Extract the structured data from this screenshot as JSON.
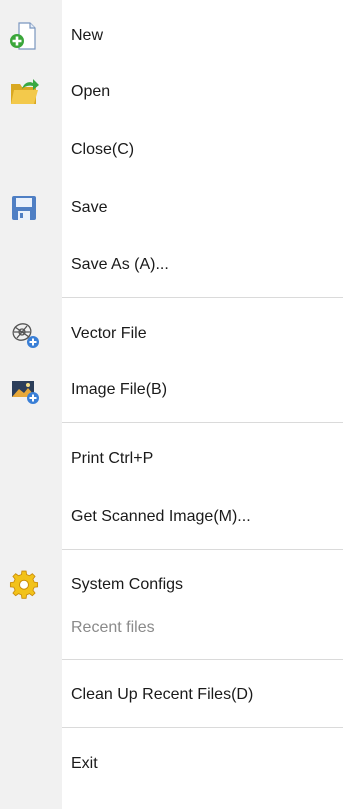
{
  "menu": {
    "new": {
      "label": "New",
      "icon": "new-file-icon"
    },
    "open": {
      "label": "Open",
      "icon": "open-folder-icon"
    },
    "close": {
      "label": "Close(C)"
    },
    "save": {
      "label": "Save",
      "icon": "save-disk-icon"
    },
    "save_as": {
      "label": "Save As (A)..."
    },
    "vector_file": {
      "label": "Vector File",
      "icon": "vector-file-icon"
    },
    "image_file": {
      "label": "Image File(B)",
      "icon": "image-file-icon"
    },
    "print": {
      "label": "Print Ctrl+P"
    },
    "get_scanned": {
      "label": "Get Scanned Image(M)..."
    },
    "system_configs": {
      "label": "System Configs",
      "icon": "gear-icon"
    },
    "recent_files": {
      "label": "Recent files",
      "disabled": true
    },
    "clean_up_recent": {
      "label": "Clean Up Recent Files(D)"
    },
    "exit": {
      "label": "Exit"
    }
  },
  "colors": {
    "gutter": "#f1f1f1",
    "text": "#1a1a1a",
    "disabled_text": "#8a8a8a",
    "separator": "#dadada"
  }
}
